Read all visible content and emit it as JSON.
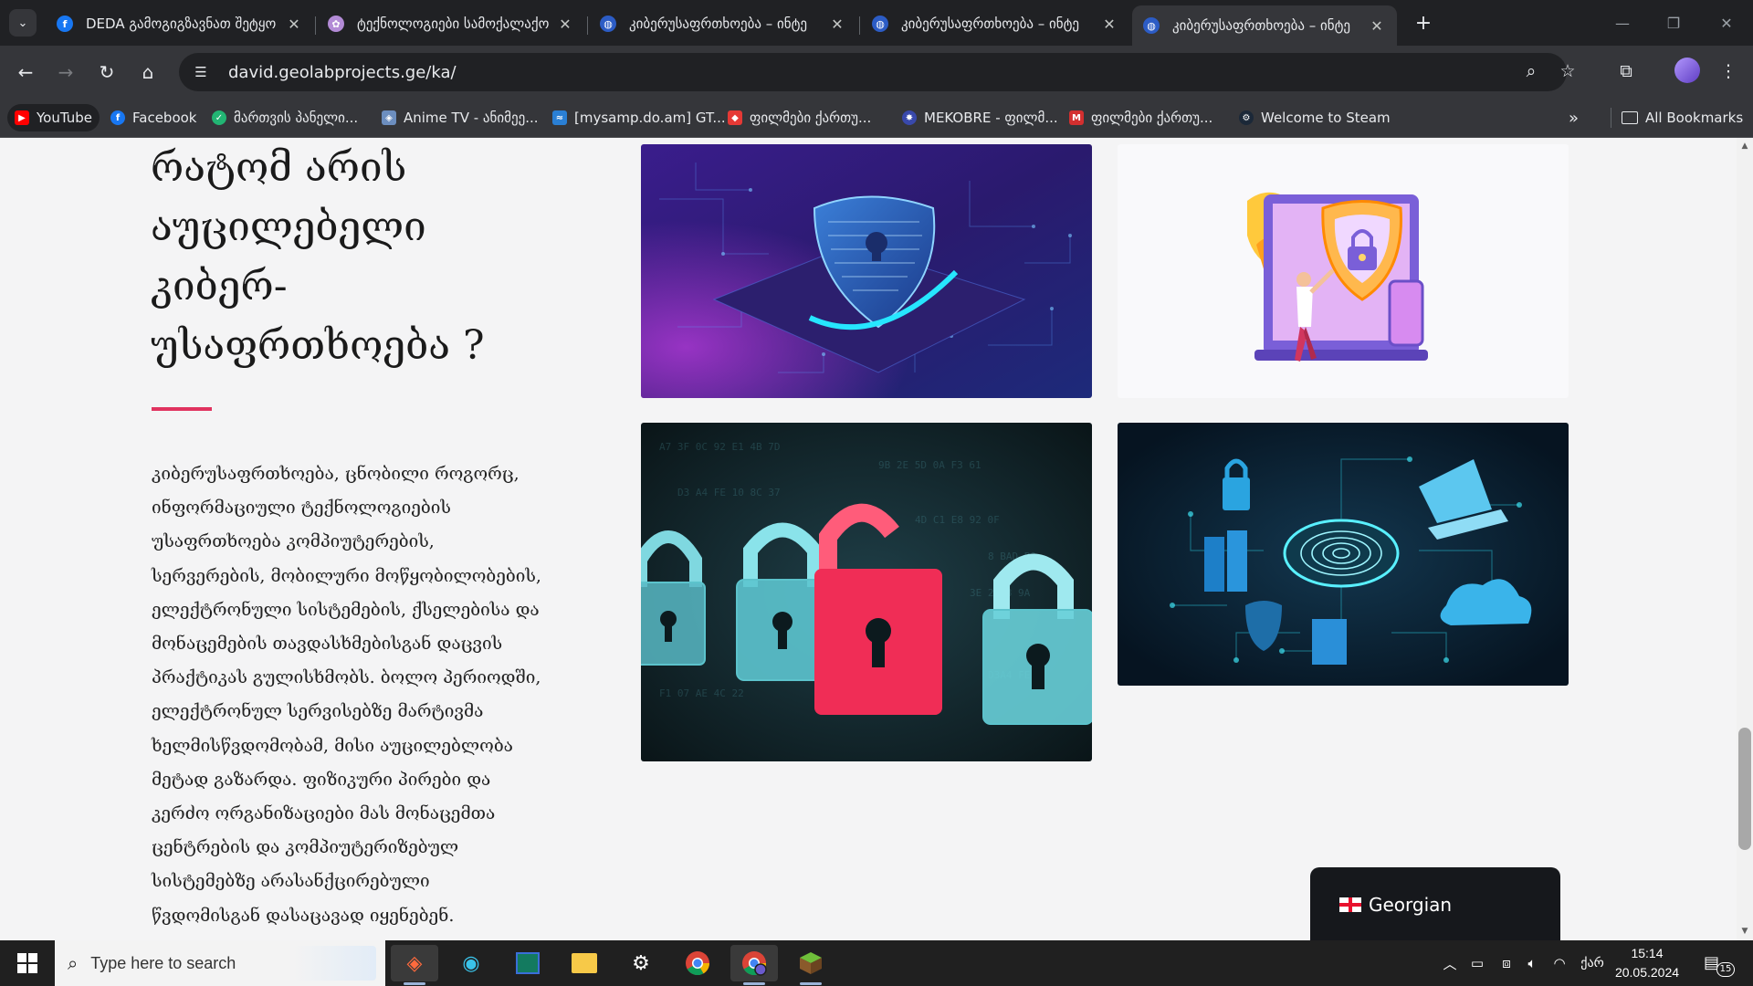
{
  "browser": {
    "tabs": [
      {
        "title": "DEDA გამოგიგზავნათ შეტყო",
        "icon": "facebook-icon",
        "color": "#1877f2",
        "active": false
      },
      {
        "title": "ტექნოლოგიები სამოქალაქო",
        "icon": "flower-icon",
        "color": "#b38bd6",
        "active": false
      },
      {
        "title": "კიბერუსაფრთხოება – ინტე",
        "icon": "globe-icon",
        "color": "#5b8def",
        "active": false
      },
      {
        "title": "კიბერუსაფრთხოება – ინტე",
        "icon": "globe-icon",
        "color": "#5b8def",
        "active": false
      },
      {
        "title": "კიბერუსაფრთხოება – ინტე",
        "icon": "globe-icon",
        "color": "#5b8def",
        "active": true
      }
    ],
    "url": "david.geolabprojects.ge/ka/",
    "bookmarks": [
      {
        "label": "YouTube",
        "color": "#ff0000"
      },
      {
        "label": "Facebook",
        "color": "#1877f2"
      },
      {
        "label": "მართვის პანელი...",
        "color": "#22b573"
      },
      {
        "label": "Anime TV - ანიმეე...",
        "color": "#6c8ebf"
      },
      {
        "label": "[mysamp.do.am] GT...",
        "color": "#2a7fd4"
      },
      {
        "label": "ფილმები ქართუ...",
        "color": "#e53935"
      },
      {
        "label": "MEKOBRE - ფილმ...",
        "color": "#3949ab"
      },
      {
        "label": "ფილმები ქართუ...",
        "color": "#d32f2f"
      },
      {
        "label": "Welcome to Steam",
        "color": "#1b2838"
      }
    ],
    "all_bookmarks": "All Bookmarks"
  },
  "page": {
    "heading_lines": [
      "რატომ არის",
      "აუცილებელი",
      "კიბერ-",
      "უსაფრთხოება ?"
    ],
    "body_lines": [
      "კიბერუსაფრთხოება, ცნობილი როგორც,",
      "ინფორმაციული ტექნოლოგიების",
      "უსაფრთხოება კომპიუტერების,",
      "სერვერების, მობილური მოწყობილობების,",
      "ელექტრონული სისტემების, ქსელებისა და",
      "მონაცემების თავდასხმებისგან დაცვის",
      "პრაქტიკას გულისხმობს. ბოლო პერიოდში,",
      "ელექტრონულ სერვისებზე მარტივმა",
      "ხელმისწვდომობამ, მისი აუცილებლობა",
      "მეტად გაზარდა. ფიზიკური პირები და",
      "კერძო ორგანიზაციები მას მონაცემთა",
      "ცენტრების და კომპიუტერიზებულ",
      "სისტემებზე არასანქცირებული",
      "წვდომისგან დასაცავად იყენებენ."
    ],
    "language_switcher": "Georgian",
    "accent_color": "#e0325f"
  },
  "taskbar": {
    "search_placeholder": "Type here to search",
    "language": "ქარ",
    "time": "15:14",
    "date": "20.05.2024",
    "notification_count": "15"
  }
}
